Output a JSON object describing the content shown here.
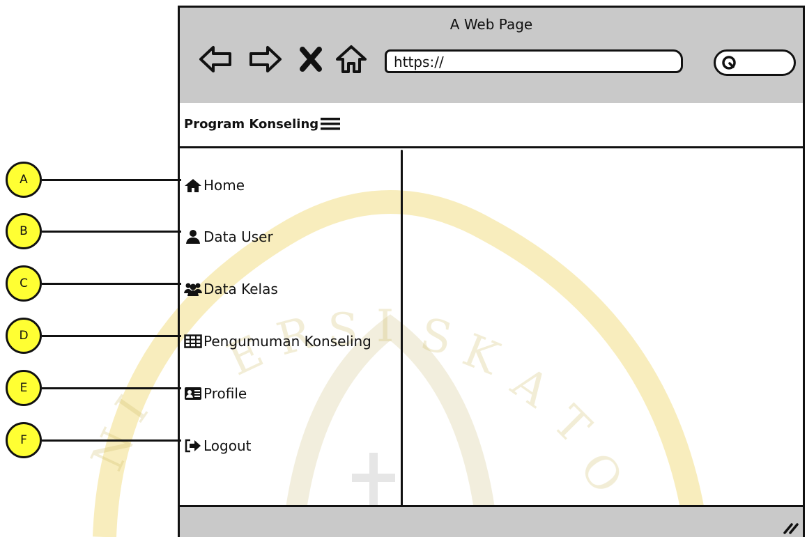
{
  "browser": {
    "title": "A Web Page",
    "url": "https://",
    "nav_icons": [
      "back-arrow-icon",
      "forward-arrow-icon",
      "close-icon",
      "home-icon"
    ],
    "search_icon": "search-icon"
  },
  "app": {
    "brand": "Program Konseling",
    "menu_icon": "hamburger-menu-icon"
  },
  "sidebar": {
    "items": [
      {
        "label": "Home",
        "icon": "home-icon"
      },
      {
        "label": " Data User",
        "icon": "user-icon"
      },
      {
        "label": "Data Kelas",
        "icon": "users-group-icon"
      },
      {
        "label": "Pengumuman Konseling",
        "icon": "table-icon"
      },
      {
        "label": "Profile",
        "icon": "id-card-icon"
      },
      {
        "label": "Logout",
        "icon": "logout-icon"
      }
    ]
  },
  "callouts": [
    "A",
    "B",
    "C",
    "D",
    "E",
    "F"
  ],
  "colors": {
    "callout": "#ffff33",
    "chrome": "#c9c9c9",
    "watermark": "#f6e27a"
  }
}
